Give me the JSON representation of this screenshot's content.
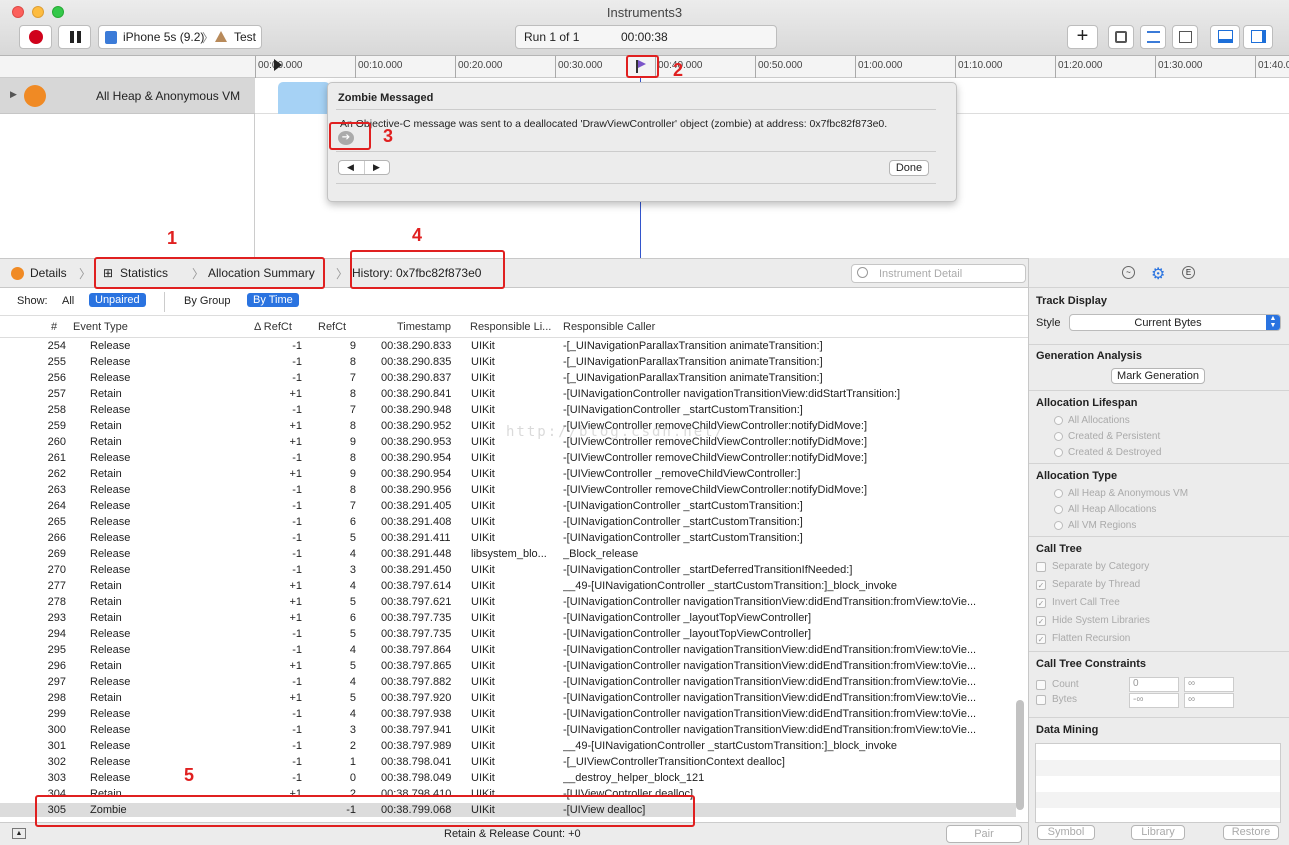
{
  "window": {
    "title": "Instruments3"
  },
  "toolbar": {
    "device": "iPhone 5s (9.2)",
    "target": "Test",
    "run": "Run 1 of 1",
    "time": "00:00:38"
  },
  "ruler": {
    "ticks": [
      "00:00.000",
      "00:10.000",
      "00:20.000",
      "00:30.000",
      "00:40.000",
      "00:50.000",
      "01:00.000",
      "01:10.000",
      "01:20.000",
      "01:30.000",
      "01:40.0"
    ]
  },
  "track": {
    "name": "All Heap & Anonymous VM"
  },
  "popover": {
    "title": "Zombie Messaged",
    "message": "An Objective-C message was sent to a deallocated 'DrawViewController' object (zombie) at address: 0x7fbc82f873e0.",
    "done_label": "Done"
  },
  "pathbar": {
    "details": "Details",
    "statistics": "Statistics",
    "allocation_summary": "Allocation Summary",
    "history": "History: 0x7fbc82f873e0",
    "search_placeholder": "Instrument Detail"
  },
  "showbar": {
    "show_label": "Show:",
    "all": "All",
    "unpaired": "Unpaired",
    "by_group": "By Group",
    "by_time": "By Time"
  },
  "table": {
    "columns": [
      "#",
      "Event Type",
      "Δ RefCt",
      "RefCt",
      "Timestamp",
      "Responsible Li...",
      "Responsible Caller"
    ],
    "rows": [
      [
        "254",
        "Release",
        "-1",
        "9",
        "00:38.290.833",
        "UIKit",
        "-[_UINavigationParallaxTransition animateTransition:]"
      ],
      [
        "255",
        "Release",
        "-1",
        "8",
        "00:38.290.835",
        "UIKit",
        "-[_UINavigationParallaxTransition animateTransition:]"
      ],
      [
        "256",
        "Release",
        "-1",
        "7",
        "00:38.290.837",
        "UIKit",
        "-[_UINavigationParallaxTransition animateTransition:]"
      ],
      [
        "257",
        "Retain",
        "+1",
        "8",
        "00:38.290.841",
        "UIKit",
        "-[UINavigationController navigationTransitionView:didStartTransition:]"
      ],
      [
        "258",
        "Release",
        "-1",
        "7",
        "00:38.290.948",
        "UIKit",
        "-[UINavigationController _startCustomTransition:]"
      ],
      [
        "259",
        "Retain",
        "+1",
        "8",
        "00:38.290.952",
        "UIKit",
        "-[UIViewController removeChildViewController:notifyDidMove:]"
      ],
      [
        "260",
        "Retain",
        "+1",
        "9",
        "00:38.290.953",
        "UIKit",
        "-[UIViewController removeChildViewController:notifyDidMove:]"
      ],
      [
        "261",
        "Release",
        "-1",
        "8",
        "00:38.290.954",
        "UIKit",
        "-[UIViewController removeChildViewController:notifyDidMove:]"
      ],
      [
        "262",
        "Retain",
        "+1",
        "9",
        "00:38.290.954",
        "UIKit",
        "-[UIViewController _removeChildViewController:]"
      ],
      [
        "263",
        "Release",
        "-1",
        "8",
        "00:38.290.956",
        "UIKit",
        "-[UIViewController removeChildViewController:notifyDidMove:]"
      ],
      [
        "264",
        "Release",
        "-1",
        "7",
        "00:38.291.405",
        "UIKit",
        "-[UINavigationController _startCustomTransition:]"
      ],
      [
        "265",
        "Release",
        "-1",
        "6",
        "00:38.291.408",
        "UIKit",
        "-[UINavigationController _startCustomTransition:]"
      ],
      [
        "266",
        "Release",
        "-1",
        "5",
        "00:38.291.411",
        "UIKit",
        "-[UINavigationController _startCustomTransition:]"
      ],
      [
        "269",
        "Release",
        "-1",
        "4",
        "00:38.291.448",
        "libsystem_blo...",
        "_Block_release"
      ],
      [
        "270",
        "Release",
        "-1",
        "3",
        "00:38.291.450",
        "UIKit",
        "-[UINavigationController _startDeferredTransitionIfNeeded:]"
      ],
      [
        "277",
        "Retain",
        "+1",
        "4",
        "00:38.797.614",
        "UIKit",
        "__49-[UINavigationController _startCustomTransition:]_block_invoke"
      ],
      [
        "278",
        "Retain",
        "+1",
        "5",
        "00:38.797.621",
        "UIKit",
        "-[UINavigationController navigationTransitionView:didEndTransition:fromView:toVie..."
      ],
      [
        "293",
        "Retain",
        "+1",
        "6",
        "00:38.797.735",
        "UIKit",
        "-[UINavigationController _layoutTopViewController]"
      ],
      [
        "294",
        "Release",
        "-1",
        "5",
        "00:38.797.735",
        "UIKit",
        "-[UINavigationController _layoutTopViewController]"
      ],
      [
        "295",
        "Release",
        "-1",
        "4",
        "00:38.797.864",
        "UIKit",
        "-[UINavigationController navigationTransitionView:didEndTransition:fromView:toVie..."
      ],
      [
        "296",
        "Retain",
        "+1",
        "5",
        "00:38.797.865",
        "UIKit",
        "-[UINavigationController navigationTransitionView:didEndTransition:fromView:toVie..."
      ],
      [
        "297",
        "Release",
        "-1",
        "4",
        "00:38.797.882",
        "UIKit",
        "-[UINavigationController navigationTransitionView:didEndTransition:fromView:toVie..."
      ],
      [
        "298",
        "Retain",
        "+1",
        "5",
        "00:38.797.920",
        "UIKit",
        "-[UINavigationController navigationTransitionView:didEndTransition:fromView:toVie..."
      ],
      [
        "299",
        "Release",
        "-1",
        "4",
        "00:38.797.938",
        "UIKit",
        "-[UINavigationController navigationTransitionView:didEndTransition:fromView:toVie..."
      ],
      [
        "300",
        "Release",
        "-1",
        "3",
        "00:38.797.941",
        "UIKit",
        "-[UINavigationController navigationTransitionView:didEndTransition:fromView:toVie..."
      ],
      [
        "301",
        "Release",
        "-1",
        "2",
        "00:38.797.989",
        "UIKit",
        "__49-[UINavigationController _startCustomTransition:]_block_invoke"
      ],
      [
        "302",
        "Release",
        "-1",
        "1",
        "00:38.798.041",
        "UIKit",
        "-[_UIViewControllerTransitionContext dealloc]"
      ],
      [
        "303",
        "Release",
        "-1",
        "0",
        "00:38.798.049",
        "UIKit",
        "__destroy_helper_block_121"
      ],
      [
        "304",
        "Retain",
        "+1",
        "2",
        "00:38.798.410",
        "UIKit",
        "-[UIViewController dealloc]"
      ],
      [
        "305",
        "Zombie",
        "",
        "-1",
        "00:38.799.068",
        "UIKit",
        "-[UIView dealloc]"
      ]
    ]
  },
  "status": {
    "text": "Retain & Release Count: +0",
    "pair": "Pair"
  },
  "inspector": {
    "track_display": "Track Display",
    "style_label": "Style",
    "style_value": "Current Bytes",
    "generation_analysis": "Generation Analysis",
    "mark_generation": "Mark Generation",
    "allocation_lifespan": "Allocation Lifespan",
    "lifespan_options": [
      "All Allocations",
      "Created & Persistent",
      "Created & Destroyed"
    ],
    "allocation_type": "Allocation Type",
    "type_options": [
      "All Heap & Anonymous VM",
      "All Heap Allocations",
      "All VM Regions"
    ],
    "call_tree": "Call Tree",
    "call_tree_options": [
      "Separate by Category",
      "Separate by Thread",
      "Invert Call Tree",
      "Hide System Libraries",
      "Flatten Recursion"
    ],
    "constraints": "Call Tree Constraints",
    "count": "Count",
    "bytes": "Bytes",
    "count_min": "0",
    "count_max": "∞",
    "bytes_min": "-∞",
    "bytes_max": "∞",
    "data_mining": "Data Mining",
    "symbol": "Symbol",
    "library": "Library",
    "restore": "Restore"
  },
  "annotations": [
    "1",
    "2",
    "3",
    "4",
    "5"
  ],
  "watermark": "http://blog.csdn.net/"
}
